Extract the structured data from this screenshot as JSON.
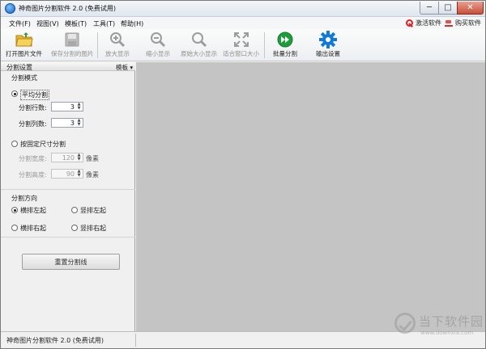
{
  "window": {
    "title": "神奇图片分割软件 2.0 (免费试用)",
    "controls": {
      "minimize": "─",
      "maximize": "□",
      "close": "✕"
    }
  },
  "menu": {
    "file": "文件(F)",
    "view": "视图(V)",
    "template": "模板(T)",
    "tools": "工具(T)",
    "help": "帮助(H)",
    "activate": "激活软件",
    "buy": "购买软件"
  },
  "toolbar": {
    "open": "打开图片文件",
    "save": "保存分割的图片",
    "zoom_in": "放大显示",
    "zoom_out": "缩小显示",
    "original_size": "原始大小显示",
    "fit_window": "适合窗口大小",
    "batch_split": "批量分割",
    "output_settings": "输出设置"
  },
  "panel": {
    "title": "分割设置",
    "template_button": "模板",
    "mode": {
      "title": "分割模式",
      "average": "平均分割",
      "rows_label": "分割行数:",
      "rows_value": "3",
      "cols_label": "分割列数:",
      "cols_value": "3",
      "fixed": "按固定尺寸分割",
      "width_label": "分割宽度:",
      "width_value": "120",
      "height_label": "分割高度:",
      "height_value": "90",
      "unit": "像素"
    },
    "direction": {
      "title": "分割方向",
      "h_left": "横排左起",
      "v_left": "竖排左起",
      "h_right": "横排右起",
      "v_right": "竖排右起"
    },
    "reset_button": "重置分割线"
  },
  "status": {
    "text": "神奇图片分割软件 2.0 (免费试用)"
  },
  "watermark": {
    "name": "当下软件园",
    "url": "www.downxia.com"
  },
  "colors": {
    "canvas": "#c4c4c4",
    "batch_icon": "#1f9d3c",
    "gear_icon": "#1479d6",
    "close_button": "#c7503a"
  }
}
